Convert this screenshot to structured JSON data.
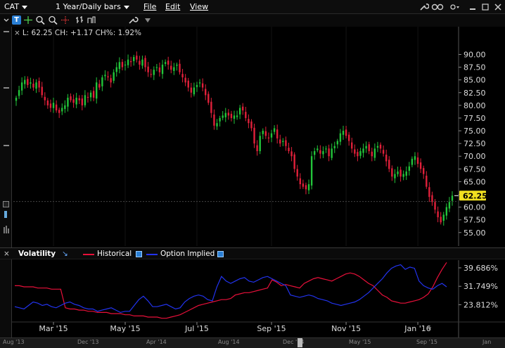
{
  "titlebar": {
    "symbol": "CAT",
    "period": "1 Year/Daily bars",
    "menu": [
      "File",
      "Edit",
      "View"
    ],
    "icons": [
      "wrench-icon",
      "link-icon",
      "dropdown-icon",
      "minimize-icon",
      "restore-icon",
      "close-icon"
    ]
  },
  "toolbar": {
    "tools": [
      "text-tool-icon",
      "crosshair-icon",
      "zoom-in-icon",
      "zoom-out-icon",
      "cursor-icon",
      "bar-type-icon",
      "indicator-icon",
      "wrench-icon",
      "dropdown-arrow-icon"
    ]
  },
  "readout": {
    "text": "L: 62.25 CH: +1.17 CH%: 1.92%"
  },
  "volatility": {
    "title": "Volatility",
    "historical_label": "Historical",
    "implied_label": "Option Implied",
    "historical_color": "#e8103a",
    "implied_color": "#2233ee"
  },
  "price_axis": {
    "last_price_label": "62.25"
  },
  "navigator": {
    "labels": [
      "Aug '13",
      "Dec '13",
      "Apr '14",
      "Aug '14",
      "Dec '14",
      "May '15",
      "Sep '15",
      "Jan"
    ]
  },
  "chart_data": [
    {
      "type": "candlestick",
      "title": "",
      "ylim": [
        54,
        92
      ],
      "y_ticks": [
        "90.00",
        "87.50",
        "85.00",
        "82.50",
        "80.00",
        "77.50",
        "75.00",
        "72.50",
        "70.00",
        "67.50",
        "65.00",
        "62.50",
        "60.00",
        "57.50",
        "55.00"
      ],
      "x_tick_labels": [
        "Mar '15",
        "May '15",
        "Jul '15",
        "Sep '15",
        "Nov '15",
        "Jan '16"
      ],
      "last_price": 62.25,
      "closes": [
        81.5,
        83.0,
        84.5,
        85.0,
        84.0,
        84.5,
        83.5,
        84.5,
        83.5,
        82.0,
        81.0,
        80.0,
        79.5,
        80.5,
        79.0,
        78.5,
        79.5,
        80.0,
        81.5,
        81.0,
        80.5,
        81.5,
        81.0,
        80.0,
        82.0,
        81.5,
        82.5,
        81.5,
        84.5,
        83.5,
        85.5,
        86.0,
        85.5,
        84.5,
        86.5,
        87.5,
        88.5,
        87.5,
        88.0,
        89.0,
        88.5,
        89.5,
        89.0,
        88.0,
        89.0,
        87.5,
        86.5,
        86.0,
        87.0,
        87.5,
        86.5,
        88.0,
        88.5,
        88.0,
        87.0,
        87.5,
        88.0,
        86.5,
        85.5,
        84.5,
        83.5,
        82.5,
        83.5,
        84.0,
        84.5,
        83.5,
        82.0,
        80.5,
        78.5,
        76.0,
        76.5,
        77.5,
        78.0,
        78.5,
        78.0,
        77.5,
        78.0,
        78.0,
        79.5,
        79.0,
        77.5,
        76.5,
        75.5,
        72.5,
        71.0,
        74.0,
        75.0,
        74.0,
        73.5,
        74.5,
        75.5,
        73.5,
        72.5,
        73.0,
        72.0,
        71.0,
        70.0,
        67.5,
        66.0,
        64.5,
        64.0,
        63.5,
        64.5,
        70.0,
        71.0,
        71.5,
        70.5,
        71.0,
        71.5,
        70.0,
        71.5,
        72.0,
        73.0,
        74.5,
        75.0,
        74.0,
        73.0,
        71.5,
        70.5,
        70.0,
        71.0,
        71.5,
        72.0,
        71.0,
        70.0,
        71.5,
        72.0,
        71.5,
        70.5,
        69.0,
        67.5,
        66.0,
        66.5,
        67.0,
        66.0,
        66.5,
        67.0,
        68.0,
        69.5,
        70.0,
        68.5,
        67.5,
        66.5,
        64.0,
        62.0,
        61.0,
        59.5,
        58.0,
        57.0,
        58.5,
        60.0,
        61.0,
        62.25
      ]
    },
    {
      "type": "line",
      "title": "Volatility",
      "y_ticks": [
        "39.686%",
        "31.749%",
        "23.812%"
      ],
      "ylim": [
        17,
        43
      ],
      "series": [
        {
          "name": "Historical",
          "values": [
            32.0,
            32.0,
            31.5,
            31.5,
            31.5,
            31.0,
            31.0,
            31.0,
            30.5,
            30.5,
            30.5,
            22.5,
            22.0,
            22.0,
            21.5,
            21.5,
            21.0,
            21.0,
            20.5,
            20.5,
            20.5,
            20.0,
            20.0,
            20.0,
            19.5,
            19.5,
            19.0,
            19.0,
            19.0,
            18.5,
            18.5,
            18.5,
            18.0,
            18.0,
            18.5,
            19.0,
            19.5,
            20.5,
            21.5,
            22.5,
            23.5,
            24.0,
            24.5,
            25.0,
            25.5,
            26.0,
            26.0,
            26.5,
            28.0,
            28.5,
            29.0,
            29.0,
            29.5,
            30.0,
            30.5,
            31.0,
            34.5,
            33.5,
            32.0,
            32.5,
            32.0,
            31.5,
            31.0,
            33.0,
            34.0,
            35.0,
            35.5,
            35.0,
            34.5,
            34.0,
            35.0,
            36.0,
            37.0,
            37.5,
            37.0,
            36.0,
            34.5,
            33.0,
            32.0,
            30.0,
            28.0,
            27.0,
            25.5,
            25.0,
            24.5,
            24.5,
            25.0,
            25.5,
            26.0,
            27.0,
            28.5,
            31.5,
            35.5,
            39.0,
            42.0
          ]
        },
        {
          "name": "Option Implied",
          "values": [
            23.0,
            22.5,
            22.0,
            23.5,
            25.0,
            24.5,
            23.5,
            24.0,
            23.0,
            22.5,
            23.5,
            24.5,
            25.0,
            24.0,
            23.5,
            22.5,
            22.0,
            22.0,
            21.0,
            21.5,
            22.0,
            22.5,
            21.5,
            20.5,
            21.0,
            21.0,
            23.5,
            26.0,
            27.5,
            25.5,
            23.0,
            23.0,
            23.5,
            24.0,
            23.0,
            22.0,
            22.5,
            25.0,
            26.5,
            27.5,
            28.0,
            27.5,
            26.0,
            25.5,
            31.5,
            36.0,
            34.0,
            33.0,
            34.0,
            35.0,
            35.5,
            34.0,
            33.5,
            34.5,
            35.5,
            36.0,
            35.0,
            34.0,
            33.0,
            32.0,
            28.0,
            27.5,
            27.0,
            27.5,
            28.0,
            27.5,
            26.5,
            26.0,
            25.5,
            24.5,
            24.0,
            23.5,
            24.0,
            24.5,
            25.0,
            26.0,
            27.5,
            29.0,
            31.0,
            33.0,
            35.0,
            37.5,
            39.5,
            40.5,
            41.0,
            39.0,
            40.0,
            39.5,
            34.0,
            32.0,
            31.0,
            30.5,
            32.0,
            33.0,
            31.5
          ]
        }
      ]
    }
  ]
}
